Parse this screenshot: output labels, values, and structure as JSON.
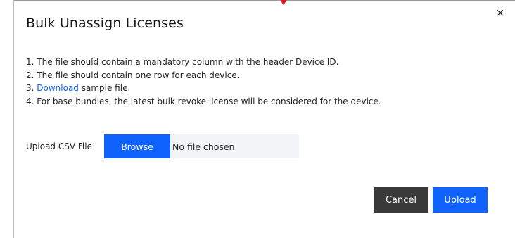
{
  "colors": {
    "primary": "#0f62fe",
    "secondary": "#393939",
    "field_bg": "#f2f4f8",
    "caret": "#da1e28"
  },
  "modal": {
    "title": "Bulk Unassign Licenses",
    "close_icon": "close-icon",
    "close_glyph": "×",
    "instructions": [
      {
        "text": "1. The file should contain a mandatory column with the header Device ID."
      },
      {
        "text": "2. The file should contain one row for each device."
      },
      {
        "prefix": "3. ",
        "link": "Download",
        "suffix": " sample file."
      },
      {
        "text": "4. For base bundles, the latest bulk revoke license will be considered for the device."
      }
    ],
    "upload": {
      "label": "Upload CSV File",
      "browse_label": "Browse",
      "file_status": "No file chosen"
    },
    "footer": {
      "cancel_label": "Cancel",
      "upload_label": "Upload"
    }
  }
}
